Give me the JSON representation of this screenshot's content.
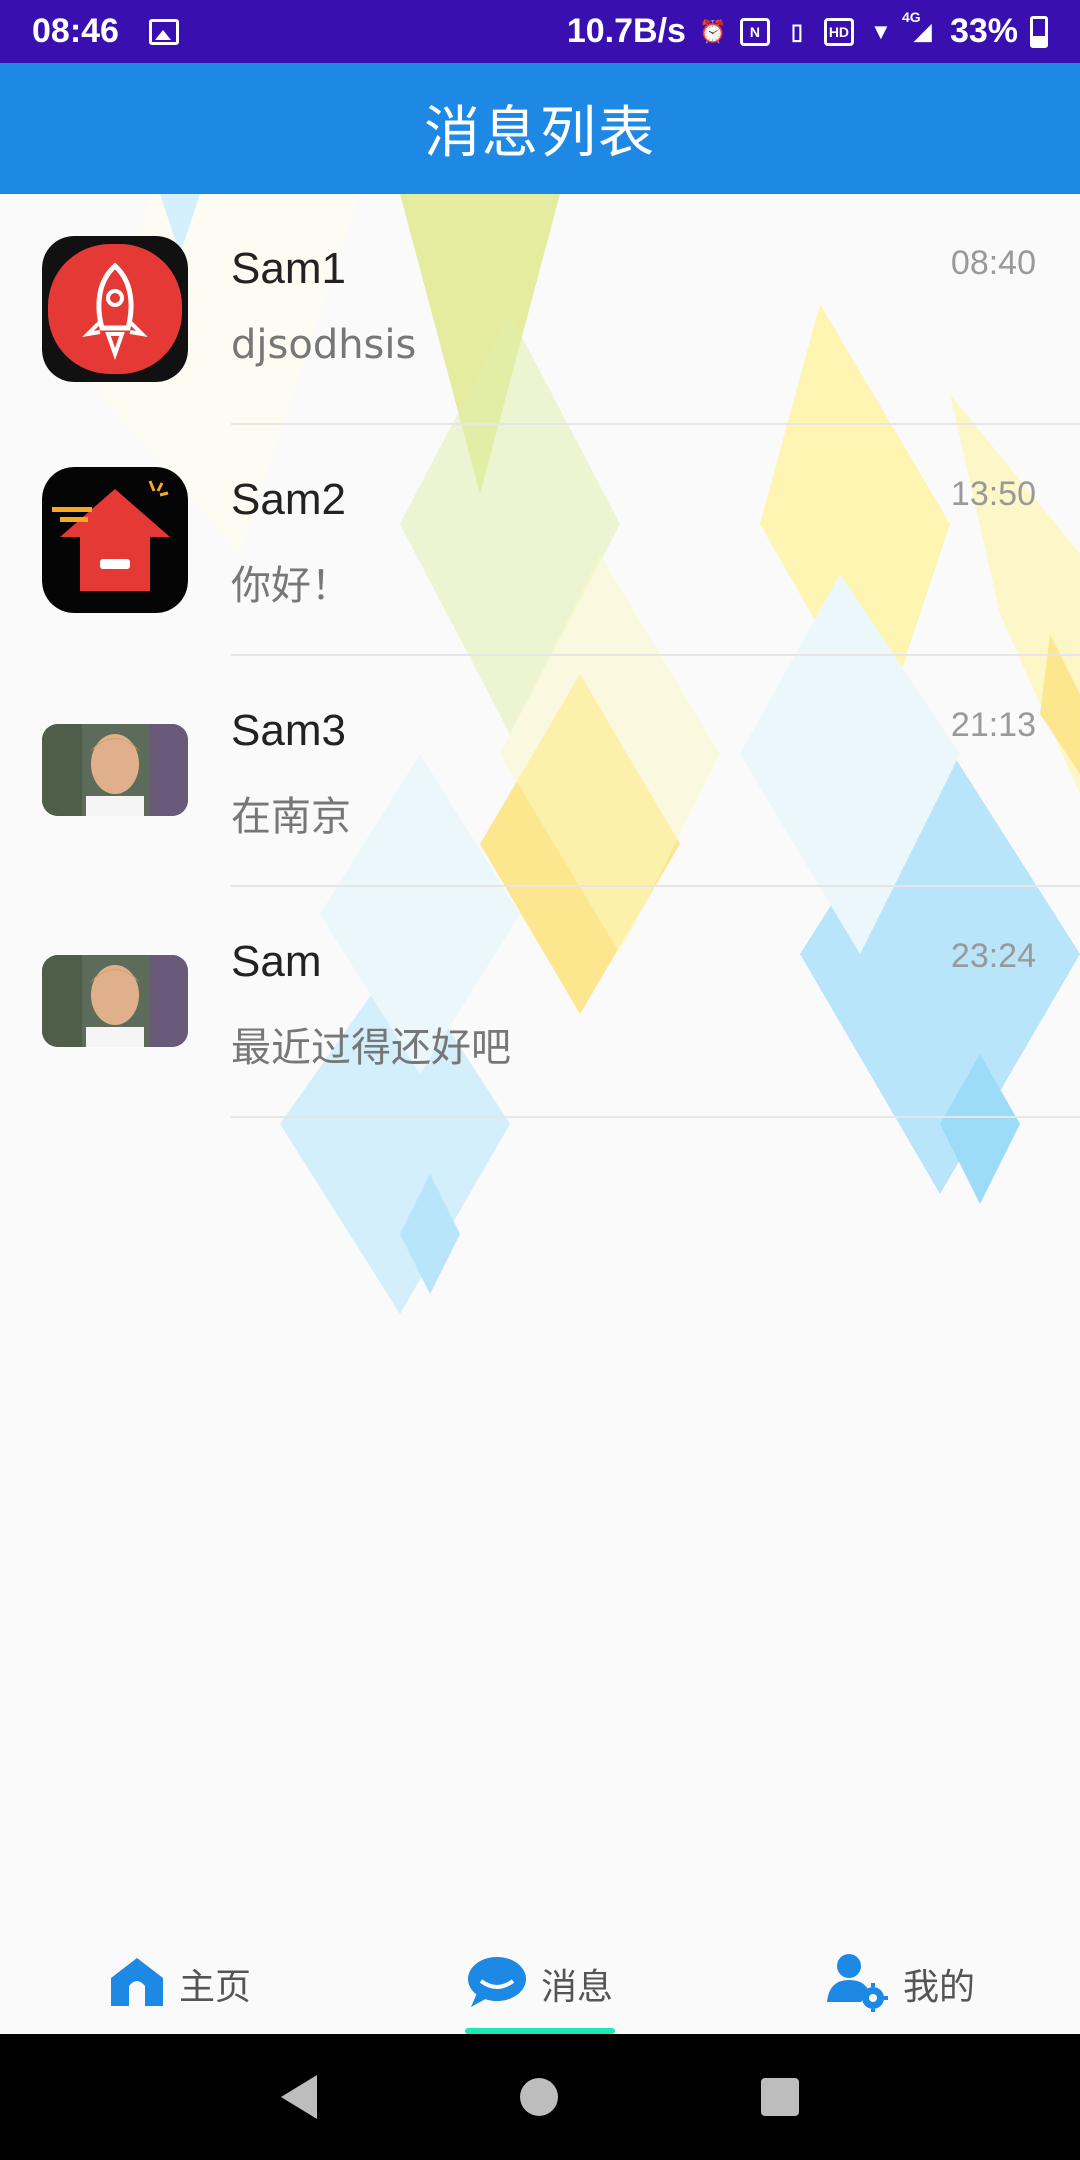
{
  "status_bar": {
    "time": "08:46",
    "net_speed": "10.7B/s",
    "network": "4G",
    "battery": "33%"
  },
  "header": {
    "title": "消息列表"
  },
  "messages": [
    {
      "name": "Sam1",
      "text": "djsodhsis",
      "time": "08:40",
      "avatar": "rocket-app-icon"
    },
    {
      "name": "Sam2",
      "text": "你好！",
      "time": "13:50",
      "avatar": "home-upload-app-icon"
    },
    {
      "name": "Sam3",
      "text": "在南京",
      "time": "21:13",
      "avatar": "person-photo"
    },
    {
      "name": "Sam",
      "text": "最近过得还好吧",
      "time": "23:24",
      "avatar": "person-photo"
    }
  ],
  "bottom_nav": {
    "items": [
      {
        "label": "主页",
        "icon": "home-icon"
      },
      {
        "label": "消息",
        "icon": "chat-bubble-icon",
        "active": true
      },
      {
        "label": "我的",
        "icon": "user-settings-icon"
      }
    ]
  },
  "colors": {
    "status_bar": "#3a0fb0",
    "title_bar": "#1e88e5",
    "nav_icon": "#1e88e5",
    "active_indicator": "#1de9b6"
  }
}
